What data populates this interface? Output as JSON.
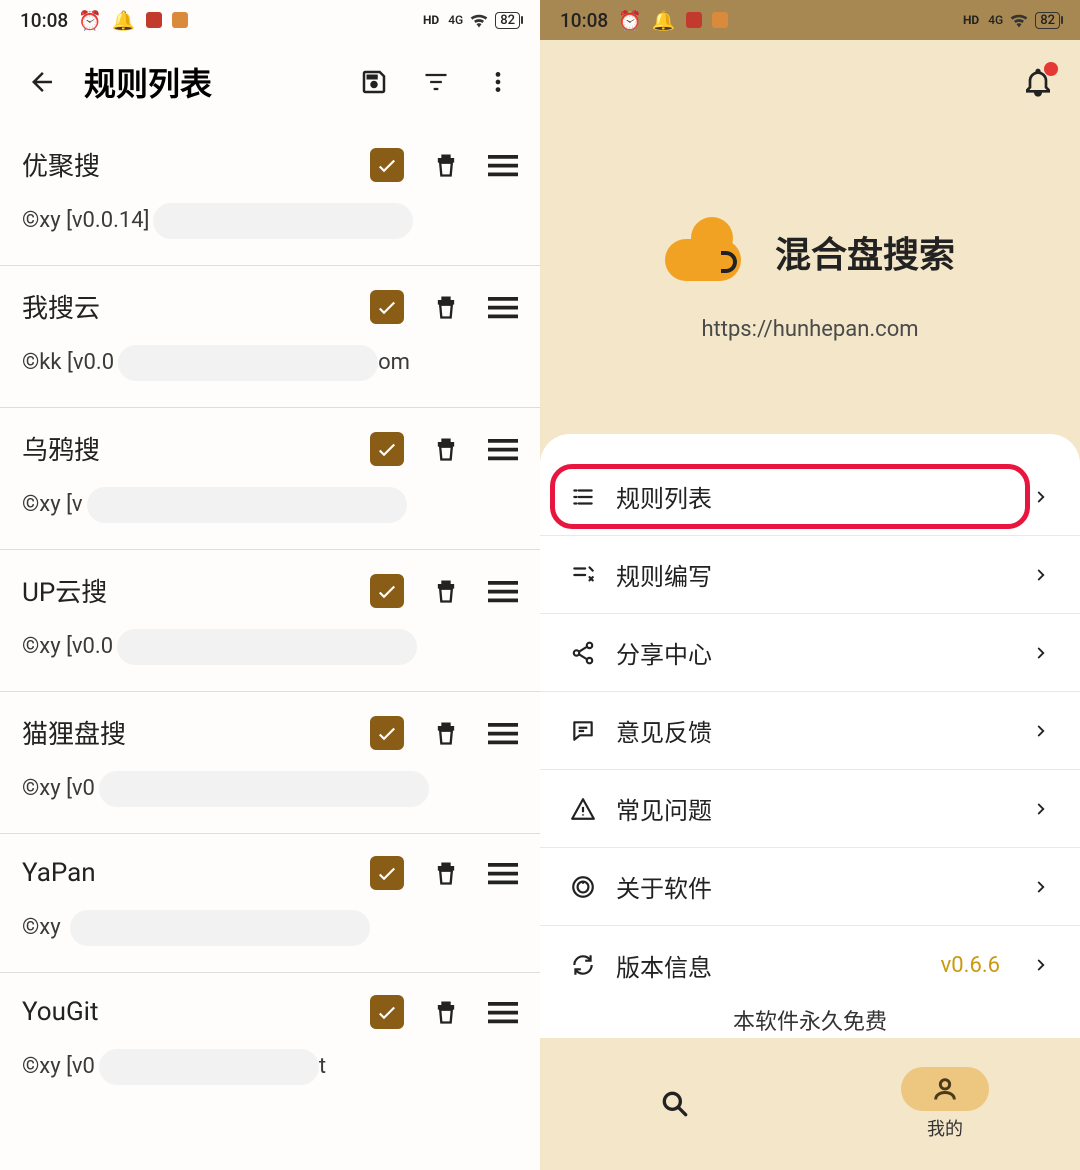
{
  "status": {
    "time": "10:08",
    "battery": "82",
    "net": "4G",
    "hd": "HD"
  },
  "left": {
    "title": "规则列表",
    "rules": [
      {
        "name": "优聚搜",
        "meta": "©xy [v0.0.14]"
      },
      {
        "name": "我搜云",
        "meta_pre": "©kk [v0.0",
        "meta_suf": "om"
      },
      {
        "name": "乌鸦搜",
        "meta": "©xy [v"
      },
      {
        "name": "UP云搜",
        "meta": "©xy [v0.0"
      },
      {
        "name": "猫狸盘搜",
        "meta": "©xy [v0"
      },
      {
        "name": "YaPan",
        "meta": "©xy "
      },
      {
        "name": "YouGit",
        "meta_pre": "©xy [v0",
        "meta_suf": "t"
      }
    ]
  },
  "right": {
    "hero_title": "混合盘搜索",
    "hero_url": "https://hunhepan.com",
    "menu": [
      {
        "label": "规则列表"
      },
      {
        "label": "规则编写"
      },
      {
        "label": "分享中心"
      },
      {
        "label": "意见反馈"
      },
      {
        "label": "常见问题"
      },
      {
        "label": "关于软件"
      },
      {
        "label": "版本信息",
        "extra": "v0.6.6"
      }
    ],
    "footer": "本软件永久免费",
    "tab_mine": "我的"
  }
}
